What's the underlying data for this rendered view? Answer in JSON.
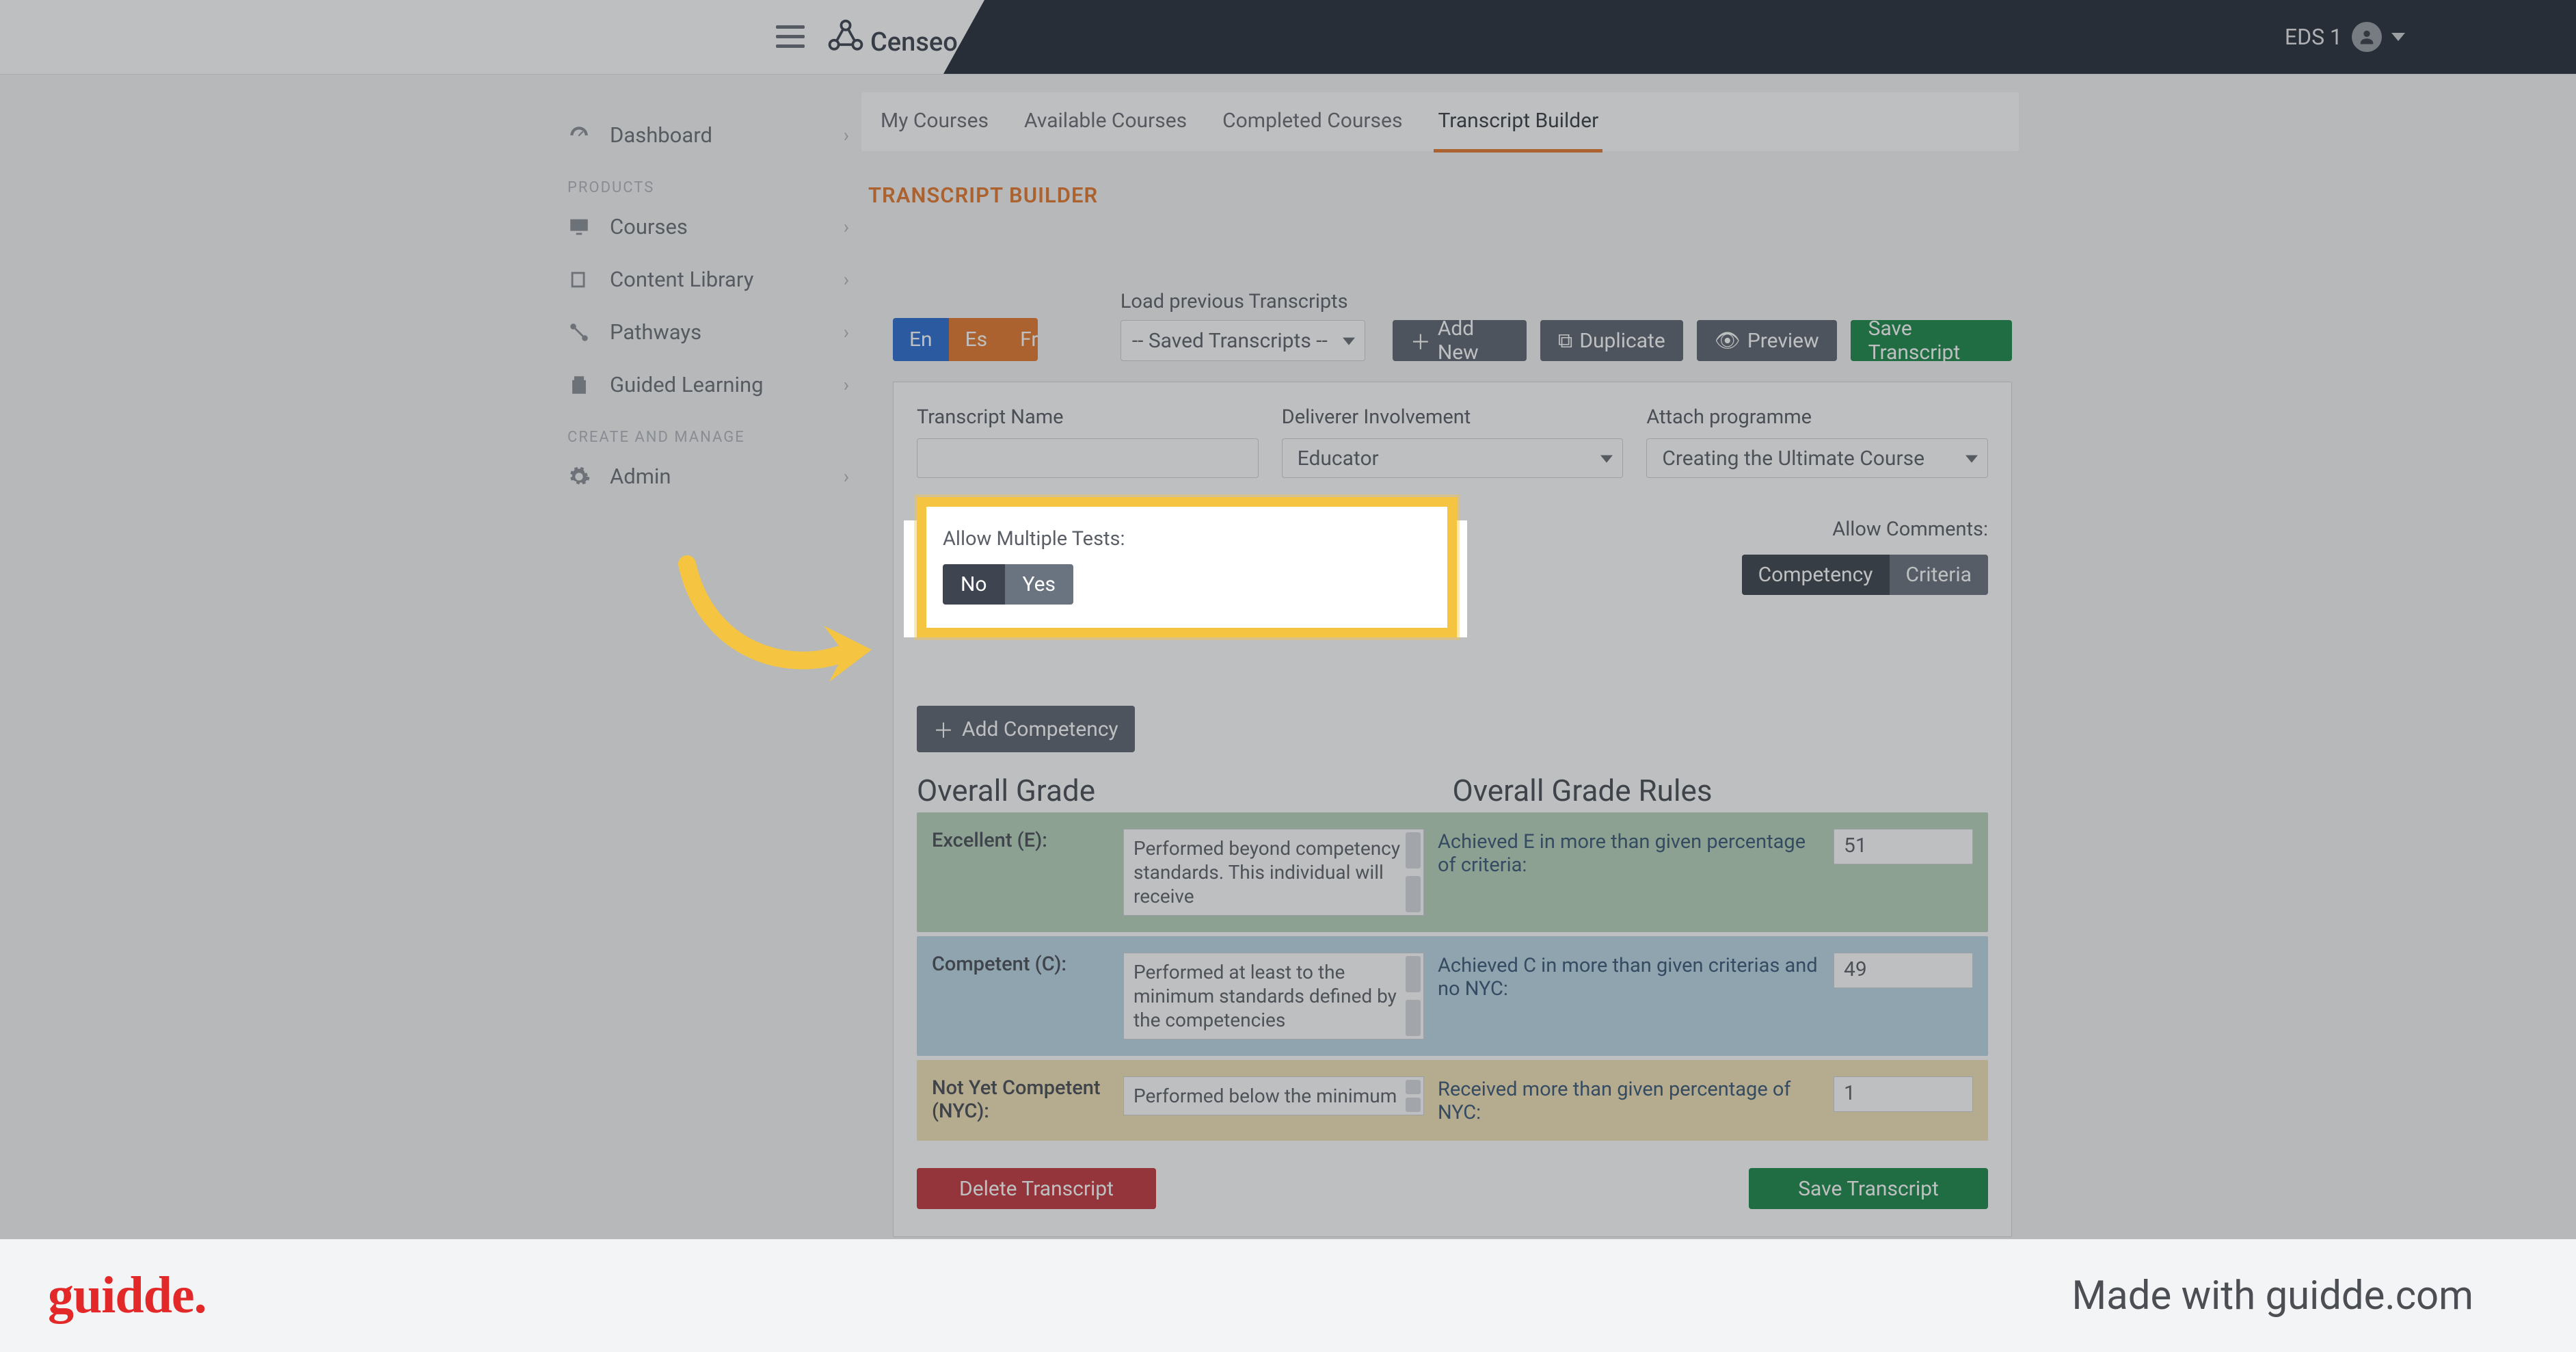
{
  "header": {
    "app_name": "Censeo",
    "user_label": "EDS 1"
  },
  "sidebar": {
    "items": [
      {
        "label": "Dashboard"
      }
    ],
    "products_label": "PRODUCTS",
    "product_items": [
      {
        "label": "Courses"
      },
      {
        "label": "Content Library"
      },
      {
        "label": "Pathways"
      },
      {
        "label": "Guided Learning"
      }
    ],
    "create_manage_label": "CREATE AND MANAGE",
    "admin_label": "Admin"
  },
  "tabs": [
    {
      "label": "My Courses",
      "active": false
    },
    {
      "label": "Available Courses",
      "active": false
    },
    {
      "label": "Completed Courses",
      "active": false
    },
    {
      "label": "Transcript Builder",
      "active": true
    }
  ],
  "section_title": "TRANSCRIPT BUILDER",
  "toolbar": {
    "lang_en": "En",
    "lang_es": "Es",
    "lang_fr": "Fr",
    "load_label": "Load previous Transcripts",
    "saved_placeholder": "-- Saved Transcripts --",
    "add_new": "Add New",
    "duplicate": "Duplicate",
    "preview": "Preview",
    "save": "Save Transcript"
  },
  "fields": {
    "name_label": "Transcript Name",
    "deliverer_label": "Deliverer Involvement",
    "deliverer_value": "Educator",
    "programme_label": "Attach programme",
    "programme_value": "Creating the Ultimate Course"
  },
  "allow_multiple": {
    "label": "Allow Multiple Tests:",
    "no": "No",
    "yes": "Yes"
  },
  "allow_comments": {
    "label": "Allow Comments:",
    "competency": "Competency",
    "criteria": "Criteria"
  },
  "add_competency": "Add Competency",
  "grade_heading_left": "Overall Grade",
  "grade_heading_right": "Overall Grade Rules",
  "grades": {
    "e": {
      "label": "Excellent (E):",
      "desc": "Performed beyond competency standards. This individual will receive",
      "rule": "Achieved E in more than given percentage of criteria:",
      "value": "51"
    },
    "c": {
      "label": "Competent (C):",
      "desc": "Performed at least to the minimum standards defined by the competencies",
      "rule": "Achieved C in more than given criterias and no NYC:",
      "value": "49"
    },
    "n": {
      "label": "Not Yet Competent (NYC):",
      "desc": "Performed below the minimum",
      "rule": "Received more than given percentage of NYC:",
      "value": "1"
    }
  },
  "footer_buttons": {
    "delete": "Delete Transcript",
    "save": "Save Transcript"
  },
  "footer_bar": {
    "logo_text": "guidde.",
    "made_with": "Made with guidde.com"
  }
}
